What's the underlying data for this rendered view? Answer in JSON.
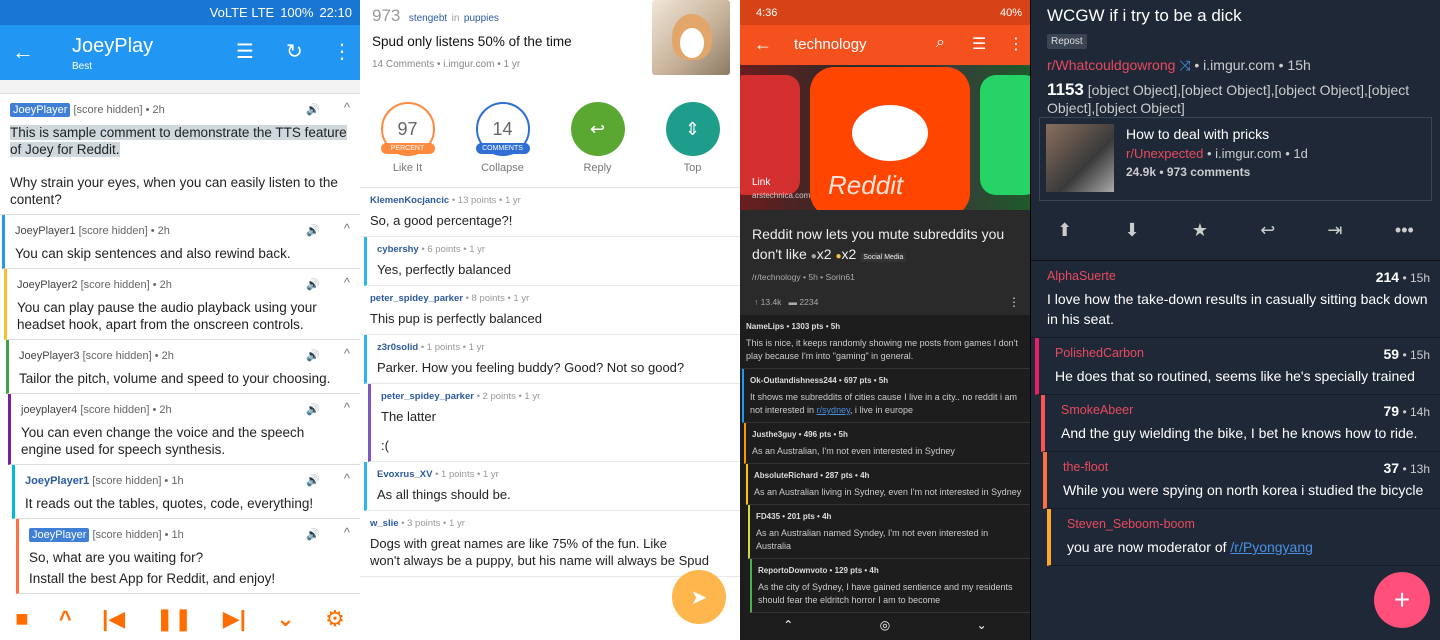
{
  "p1": {
    "status": {
      "net": "VoLTE LTE",
      "battery": "100%",
      "time": "22:10"
    },
    "title": "JoeyPlay",
    "subtitle": "Best",
    "comments": [
      {
        "user": "JoeyPlayer",
        "meta": "[score hidden] • 2h",
        "text1": "This is sample comment to demonstrate the TTS feature of Joey for Reddit.",
        "text2": "Why strain your eyes, when you can easily listen to the content?",
        "color": "#ffffff"
      },
      {
        "user": "JoeyPlayer1",
        "meta": "[score hidden] • 2h",
        "text1": "You can skip sentences and also rewind back.",
        "color": "#2196f3"
      },
      {
        "user": "JoeyPlayer2",
        "meta": "[score hidden] • 2h",
        "text1": "You can play pause the audio playback using your headset hook, apart from the onscreen controls.",
        "color": "#fbc02d"
      },
      {
        "user": "JoeyPlayer3",
        "meta": "[score hidden] • 2h",
        "text1": "Tailor the pitch, volume and speed to your choosing.",
        "color": "#43a047"
      },
      {
        "user": "joeyplayer4",
        "meta": "[score hidden] • 2h",
        "text1": "You can even change the voice and the speech engine used for speech synthesis.",
        "color": "#7b1fa2"
      },
      {
        "user": "JoeyPlayer1",
        "meta": "[score hidden] • 1h",
        "text1": "It reads out the tables, quotes, code, everything!",
        "color": "#00bcd4"
      },
      {
        "user": "JoeyPlayer",
        "meta": "[score hidden] • 1h",
        "text1": "So, what are you waiting for?",
        "text2": "Install the best App for Reddit, and enjoy!",
        "color": "#ff7043"
      }
    ]
  },
  "p2": {
    "post": {
      "score": "973",
      "author": "stengebt",
      "in": "in",
      "sub": "puppies",
      "title": "Spud only listens 50% of the time",
      "meta": "14 Comments • i.imgur.com • 1 yr"
    },
    "actions": [
      {
        "value": "97",
        "tag": "PERCENT",
        "label": "Like It"
      },
      {
        "value": "14",
        "tag": "COMMENTS",
        "label": "Collapse"
      },
      {
        "label": "Reply"
      },
      {
        "label": "Top"
      }
    ],
    "comments": [
      {
        "user": "KlemenKocjancic",
        "meta": "• 13 points • 1 yr",
        "text": "So, a good percentage?!"
      },
      {
        "user": "cybershy",
        "meta": "• 6 points • 1 yr",
        "text": "Yes, perfectly balanced"
      },
      {
        "user": "peter_spidey_parker",
        "meta": "• 8 points • 1 yr",
        "text": "This pup is perfectly balanced"
      },
      {
        "user": "z3r0solid",
        "meta": "• 1 points • 1 yr",
        "text": "Parker. How you feeling buddy? Good? Not so good?"
      },
      {
        "user": "peter_spidey_parker",
        "meta": "• 2 points • 1 yr",
        "text": "The latter",
        "text2": ":("
      },
      {
        "user": "Evoxrus_XV",
        "meta": "• 1 points • 1 yr",
        "text": "As all things should be."
      },
      {
        "user": "w_slie",
        "meta": "• 3 points • 1 yr",
        "text": "Dogs with great names are like 75% of the fun. Like",
        "text2": "won't always be a puppy, but his name will always be Spud"
      }
    ]
  },
  "p3": {
    "status": {
      "time": "4:36",
      "battery": "40%"
    },
    "title": "technology",
    "hero": {
      "word": "Reddit",
      "link": "Link",
      "src": "arstechnica.com"
    },
    "post": {
      "title": "Reddit now lets you mute subreddits you don't like",
      "awards1": "x2",
      "awards2": "x2",
      "flair": "Social Media",
      "sub": "/r/technology • 5h • Sorin61",
      "ups": "13.4k",
      "comments": "2234"
    },
    "comments": [
      {
        "meta": "NameLips • 1303 pts • 5h",
        "text": "This is nice, it keeps randomly showing me posts from games I don't play because I'm into \"gaming\" in general.",
        "color": ""
      },
      {
        "meta": "Ok-Outlandishness244 • 697 pts • 5h",
        "text": "It shows me subreddits of cities cause I live in a city.. no reddit i am not interested in",
        "link": "r/sydney",
        "text2": ", i live in europe",
        "color": "#2196f3"
      },
      {
        "meta": "Justhe3guy • 496 pts • 5h",
        "text": "As an Australian, I'm not even interested in Sydney",
        "color": "#ff9800"
      },
      {
        "meta": "AbsoluteRichard • 287 pts • 4h",
        "text": "As an Australian living in Sydney, even I'm not interested in Sydney",
        "color": "#ffc107"
      },
      {
        "meta": "FD435 • 201 pts • 4h",
        "text": "As an Australian named Syndey, I'm not even interested in Australia",
        "color": "#cddc39"
      },
      {
        "meta": "ReportoDownvoto • 129 pts • 4h",
        "text": "As the city of Sydney, I have gained sentience and my residents should fear the eldritch horror I am to become",
        "color": "#4caf50"
      }
    ]
  },
  "p4": {
    "title": "WCGW if i try to be a dick",
    "tag": "Repost",
    "sub": "r/Whatcouldgowrong",
    "domain": "• i.imgur.com • 15h",
    "score": "1153",
    "comments": [
      {
        "user": "AlphaSuerte",
        "score": "214",
        "age": "• 15h",
        "text": "I love how the take-down results in casually sitting back down in his seat.",
        "color": ""
      },
      {
        "user": "PolishedCarbon",
        "score": "59",
        "age": "• 15h",
        "text": "He does that so routined, seems like he's specially trained",
        "color": "#e91e63"
      },
      {
        "user": "SmokeAbeer",
        "score": "79",
        "age": "• 14h",
        "text": "And the guy wielding the bike, I bet he knows how to ride.",
        "color": "#ff5252"
      },
      {
        "user": "the-floot",
        "score": "37",
        "age": "• 13h",
        "text": "While you were spying on north korea i studied the bicycle",
        "color": "#ff7043"
      },
      {
        "user": "Steven_Seboom-boom",
        "score": "",
        "age": "",
        "text": "you are now moderator of",
        "link": "/r/Pyongyang",
        "color": "#ffa726"
      }
    ],
    "xpost": {
      "title": "How to deal with pricks",
      "sub": "r/Unexpected",
      "meta": "• i.imgur.com • 1d",
      "stats": "24.9k • 973 comments"
    }
  }
}
